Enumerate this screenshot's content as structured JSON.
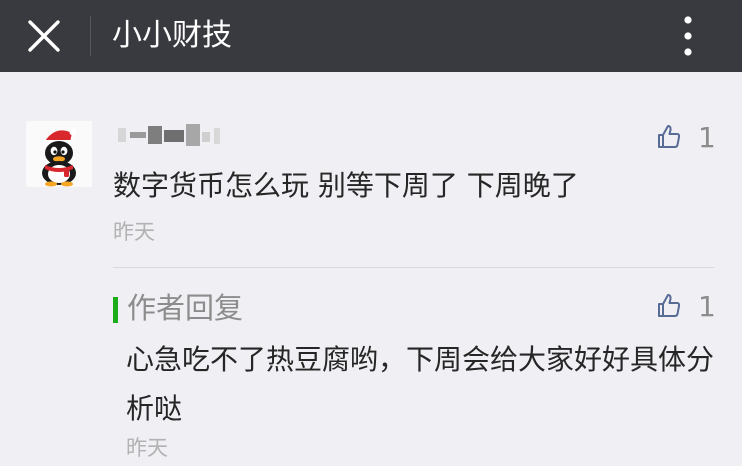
{
  "header": {
    "title": "小小财技",
    "close_icon": "close-icon",
    "more_icon": "more-vertical-icon"
  },
  "comment": {
    "avatar_icon": "qq-penguin-avatar",
    "text": "数字货币怎么玩 别等下周了 下周晚了",
    "time": "昨天",
    "likes": "1",
    "like_icon": "thumbs-up-icon"
  },
  "reply": {
    "label": "作者回复",
    "text": "心急吃不了热豆腐哟，下周会给大家好好具体分析哒",
    "time": "昨天",
    "likes": "1",
    "like_icon": "thumbs-up-icon"
  },
  "colors": {
    "header_bg": "#393a3f",
    "page_bg": "#efeff4",
    "accent_green": "#1aad19"
  }
}
